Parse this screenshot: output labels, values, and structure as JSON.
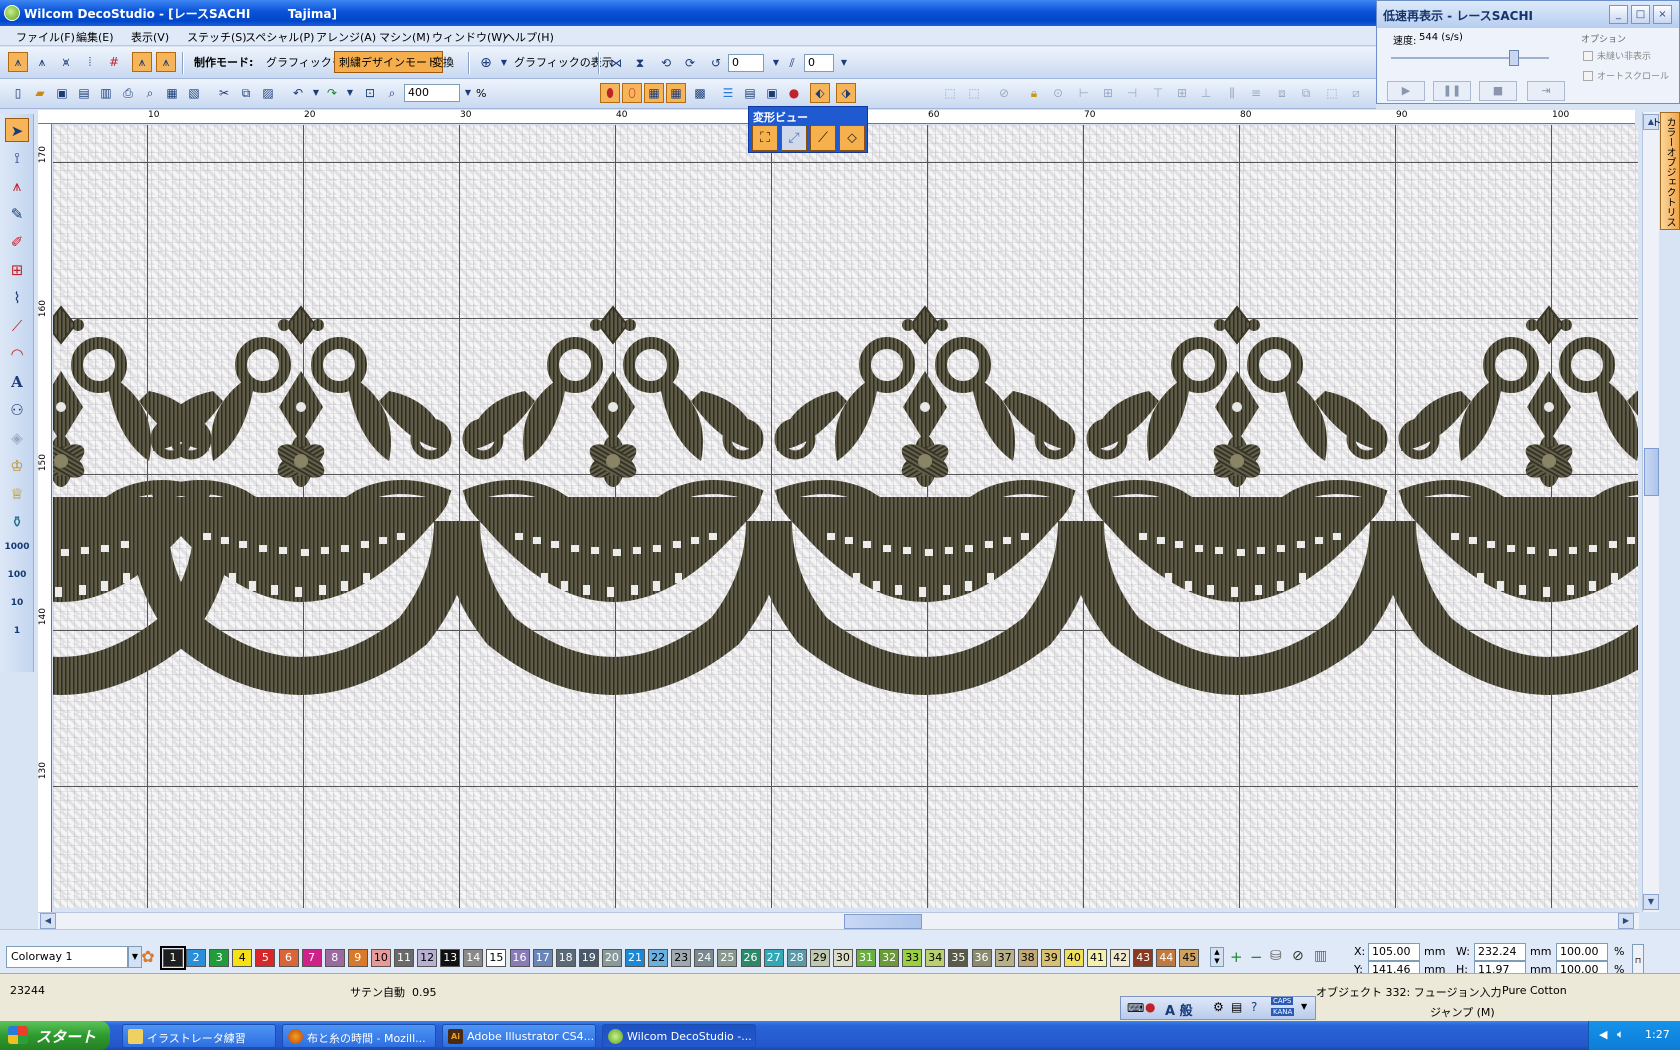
{
  "window": {
    "title": "Wilcom DecoStudio - [レースSACHI         Tajima]"
  },
  "menu": [
    "ファイル(F)",
    "編集(E)",
    "表示(V)",
    "ステッチ(S)",
    "スペシャル(P)",
    "アレンジ(A)",
    "マシン(M)",
    "ウィンドウ(W)",
    "ヘルプ(H)"
  ],
  "toolbar1": {
    "mode_label": "制作モード:",
    "graphic_mode": "グラフィックモード",
    "embroidery_mode": "刺繍デザインモード",
    "convert": "変換",
    "show_graphics": "グラフィックの表示",
    "rotate_value": "0",
    "slant_value": "0"
  },
  "toolbar2": {
    "zoom_value": "400",
    "zoom_unit": "%"
  },
  "playback": {
    "title": "低速再表示 - レースSACHI",
    "speed_label": "速度:",
    "speed_value": "544 (s/s)",
    "options_label": "オプション",
    "option1": "未縫い非表示",
    "option2": "オートスクロール"
  },
  "morph_view": {
    "title": "変形ビュー"
  },
  "side_tab": {
    "label": "カラーオブジェクトリスト"
  },
  "ruler": {
    "top_labels": [
      "10",
      "20",
      "30",
      "40",
      "50",
      "60",
      "70",
      "80",
      "90",
      "100"
    ],
    "left_labels": [
      "170",
      "160",
      "150",
      "140",
      "130"
    ]
  },
  "toolbox": {
    "scale_labels": [
      "1000",
      "100",
      "10",
      "1"
    ]
  },
  "palette": {
    "colorway": "Colorway 1",
    "swatches": [
      {
        "n": "1",
        "c": "#1e1e1e",
        "t": "#ffffff"
      },
      {
        "n": "2",
        "c": "#2a8fd8",
        "t": "#ffffff"
      },
      {
        "n": "3",
        "c": "#1f9d3a",
        "t": "#ffffff"
      },
      {
        "n": "4",
        "c": "#f7e018",
        "t": "#000000"
      },
      {
        "n": "5",
        "c": "#d8262a",
        "t": "#ffffff"
      },
      {
        "n": "6",
        "c": "#d8663a",
        "t": "#ffffff"
      },
      {
        "n": "7",
        "c": "#d0208a",
        "t": "#ffffff"
      },
      {
        "n": "8",
        "c": "#9a6aa0",
        "t": "#ffffff"
      },
      {
        "n": "9",
        "c": "#d87a2a",
        "t": "#ffffff"
      },
      {
        "n": "10",
        "c": "#e89a9a",
        "t": "#000000"
      },
      {
        "n": "11",
        "c": "#6a6a6a",
        "t": "#ffffff"
      },
      {
        "n": "12",
        "c": "#b8b0d0",
        "t": "#000000"
      },
      {
        "n": "13",
        "c": "#101010",
        "t": "#ffffff"
      },
      {
        "n": "14",
        "c": "#8a8a8a",
        "t": "#ffffff"
      },
      {
        "n": "15",
        "c": "#ffffff",
        "t": "#000000"
      },
      {
        "n": "16",
        "c": "#8a7ab8",
        "t": "#ffffff"
      },
      {
        "n": "17",
        "c": "#6a86b8",
        "t": "#ffffff"
      },
      {
        "n": "18",
        "c": "#5a6a78",
        "t": "#ffffff"
      },
      {
        "n": "19",
        "c": "#4a5a6a",
        "t": "#ffffff"
      },
      {
        "n": "20",
        "c": "#8a9a9a",
        "t": "#ffffff"
      },
      {
        "n": "21",
        "c": "#1a8ad8",
        "t": "#ffffff"
      },
      {
        "n": "22",
        "c": "#6ab0e0",
        "t": "#000000"
      },
      {
        "n": "23",
        "c": "#a0a8b0",
        "t": "#000000"
      },
      {
        "n": "24",
        "c": "#7a8890",
        "t": "#ffffff"
      },
      {
        "n": "25",
        "c": "#8a9890",
        "t": "#ffffff"
      },
      {
        "n": "26",
        "c": "#2a8a6a",
        "t": "#ffffff"
      },
      {
        "n": "27",
        "c": "#30a8b8",
        "t": "#ffffff"
      },
      {
        "n": "28",
        "c": "#5a9aa8",
        "t": "#ffffff"
      },
      {
        "n": "29",
        "c": "#c0c8b0",
        "t": "#000000"
      },
      {
        "n": "30",
        "c": "#dcdcc8",
        "t": "#000000"
      },
      {
        "n": "31",
        "c": "#6ab040",
        "t": "#ffffff"
      },
      {
        "n": "32",
        "c": "#6a9a3a",
        "t": "#ffffff"
      },
      {
        "n": "33",
        "c": "#9ad040",
        "t": "#000000"
      },
      {
        "n": "34",
        "c": "#b8d070",
        "t": "#000000"
      },
      {
        "n": "35",
        "c": "#5a5a48",
        "t": "#ffffff"
      },
      {
        "n": "36",
        "c": "#8a8a70",
        "t": "#ffffff"
      },
      {
        "n": "37",
        "c": "#b8b088",
        "t": "#000000"
      },
      {
        "n": "38",
        "c": "#c0a878",
        "t": "#000000"
      },
      {
        "n": "39",
        "c": "#d8c070",
        "t": "#000000"
      },
      {
        "n": "40",
        "c": "#f0e060",
        "t": "#000000"
      },
      {
        "n": "41",
        "c": "#f4f0b0",
        "t": "#000000"
      },
      {
        "n": "42",
        "c": "#f0e8d0",
        "t": "#000000"
      },
      {
        "n": "43",
        "c": "#8a3a20",
        "t": "#ffffff"
      },
      {
        "n": "44",
        "c": "#c07a40",
        "t": "#ffffff"
      },
      {
        "n": "45",
        "c": "#d0a060",
        "t": "#000000"
      }
    ]
  },
  "coords": {
    "x_label": "X:",
    "x_value": "105.00",
    "x_unit": "mm",
    "y_label": "Y:",
    "y_value": "141.46",
    "y_unit": "mm",
    "w_label": "W:",
    "w_value": "232.24",
    "w_unit": "mm",
    "h_label": "H:",
    "h_value": "11.97",
    "h_unit": "mm",
    "sx_value": "100.00",
    "sy_value": "100.00",
    "pct": "%"
  },
  "status": {
    "stitch_count": "23244",
    "stitch_type": "サテン自動  0.95",
    "object_info": "オブジェクト 332: フュージョン入力",
    "fabric": "Pure Cotton",
    "jump": "ジャンプ (M)",
    "ime_text": "A 般",
    "caps": "CAPS",
    "kana": "KANA"
  },
  "taskbar": {
    "start": "スタート",
    "items": [
      "イラストレータ練習",
      "布と糸の時間 - Mozill...",
      "Adobe Illustrator CS4...",
      "Wilcom DecoStudio -..."
    ],
    "clock": "1:27"
  }
}
